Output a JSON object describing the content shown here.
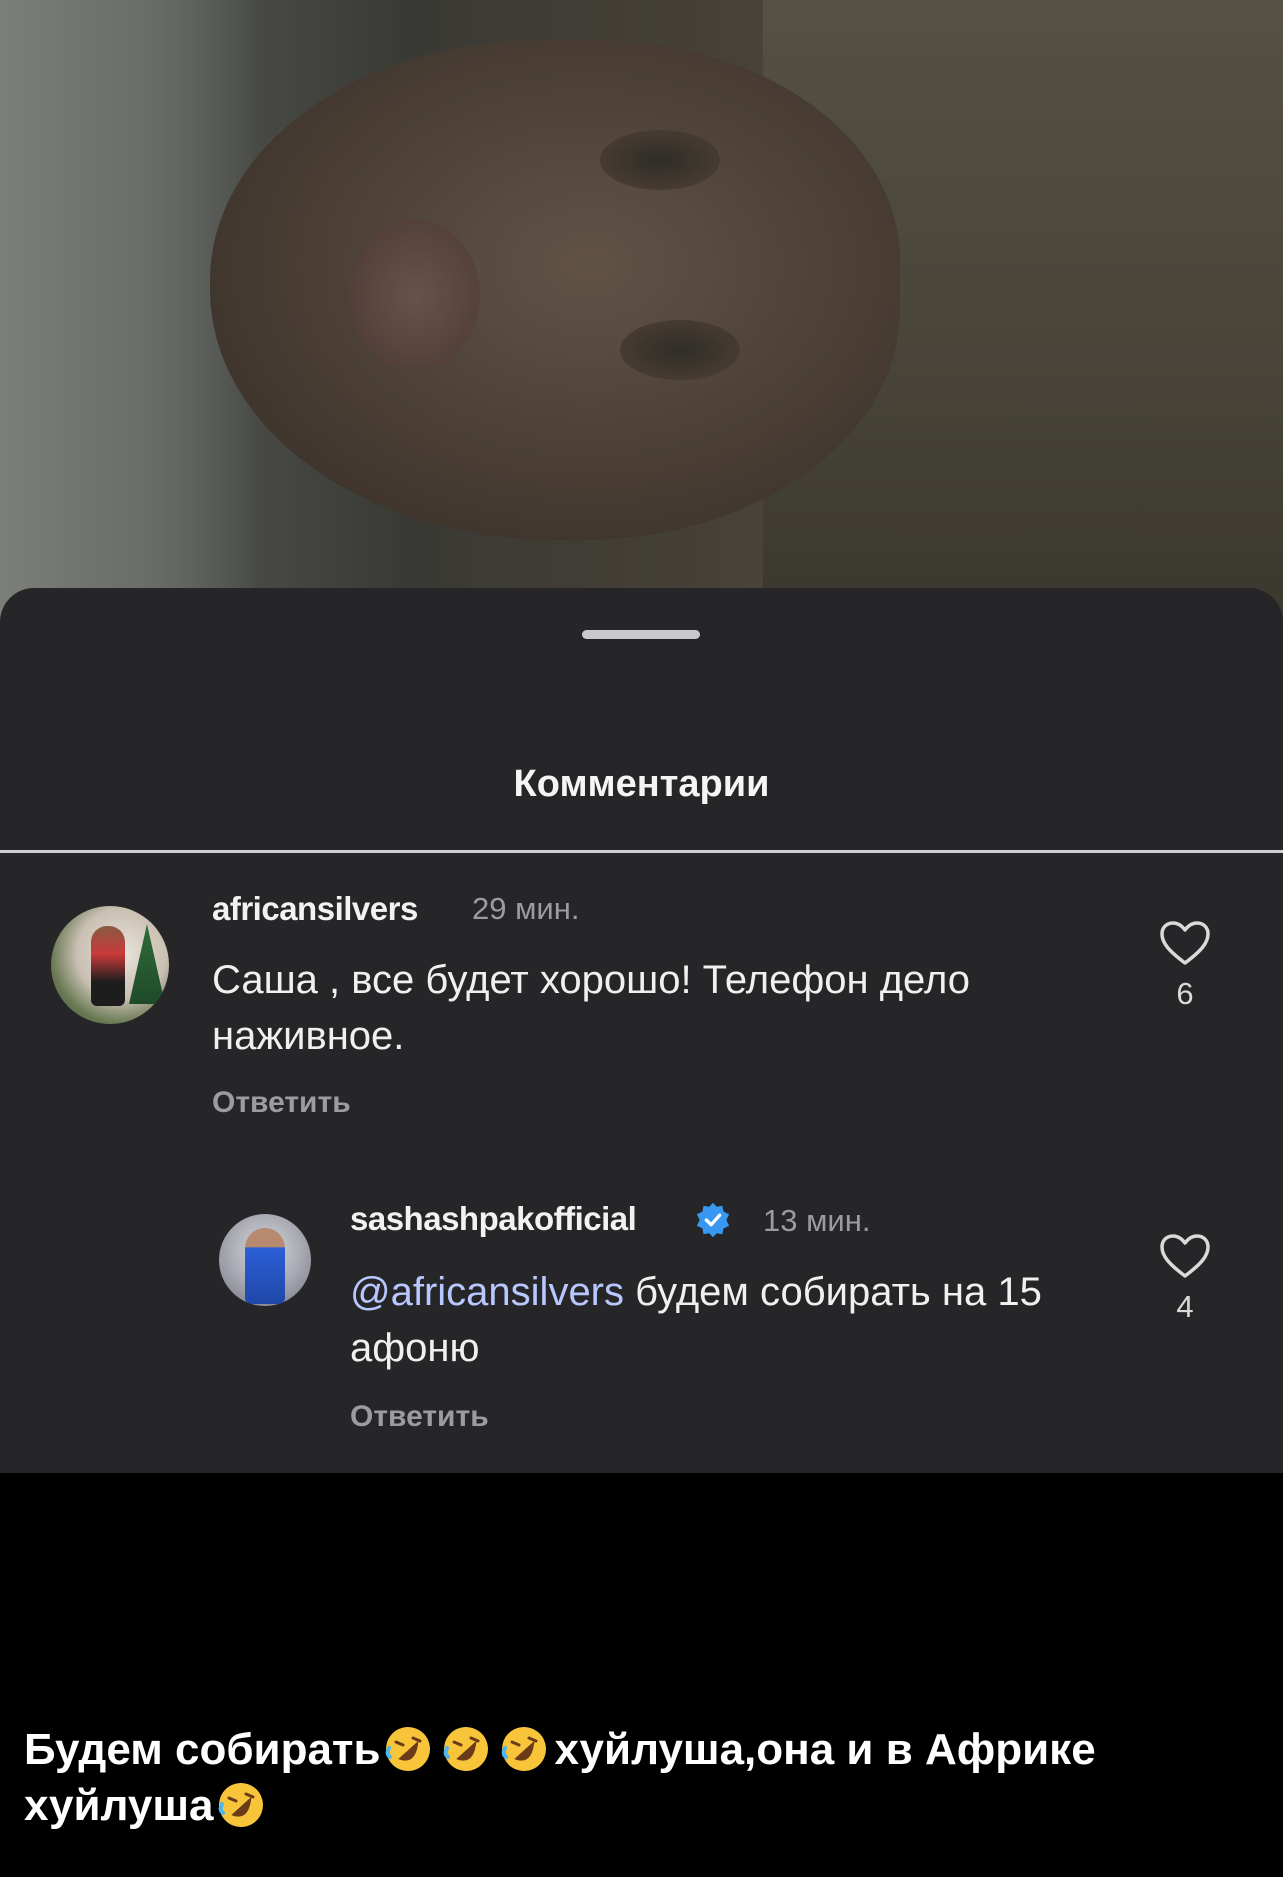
{
  "sheet": {
    "title": "Комментарии"
  },
  "comments": [
    {
      "username": "africansilvers",
      "time": "29 мин.",
      "text": "Саша , все будет хорошо!  Телефон дело наживное.",
      "reply_label": "Ответить",
      "likes": "6"
    },
    {
      "username": "sashashpakofficial",
      "verified": true,
      "time": "13 мин.",
      "mention": "@africansilvers",
      "text": " будем собирать на 15 афоню",
      "reply_label": "Ответить",
      "likes": "4"
    }
  ],
  "caption": {
    "part1": "Будем собирать",
    "part2": "хуйлуша,она и в Африке хуйлуша",
    "emoji": "rolling-on-floor-laughing-icon"
  },
  "colors": {
    "sheet_bg": "#262628",
    "text": "#f0f0f0",
    "muted": "#9c9ca0",
    "verified": "#3897f0",
    "caption_bg": "#000000"
  }
}
